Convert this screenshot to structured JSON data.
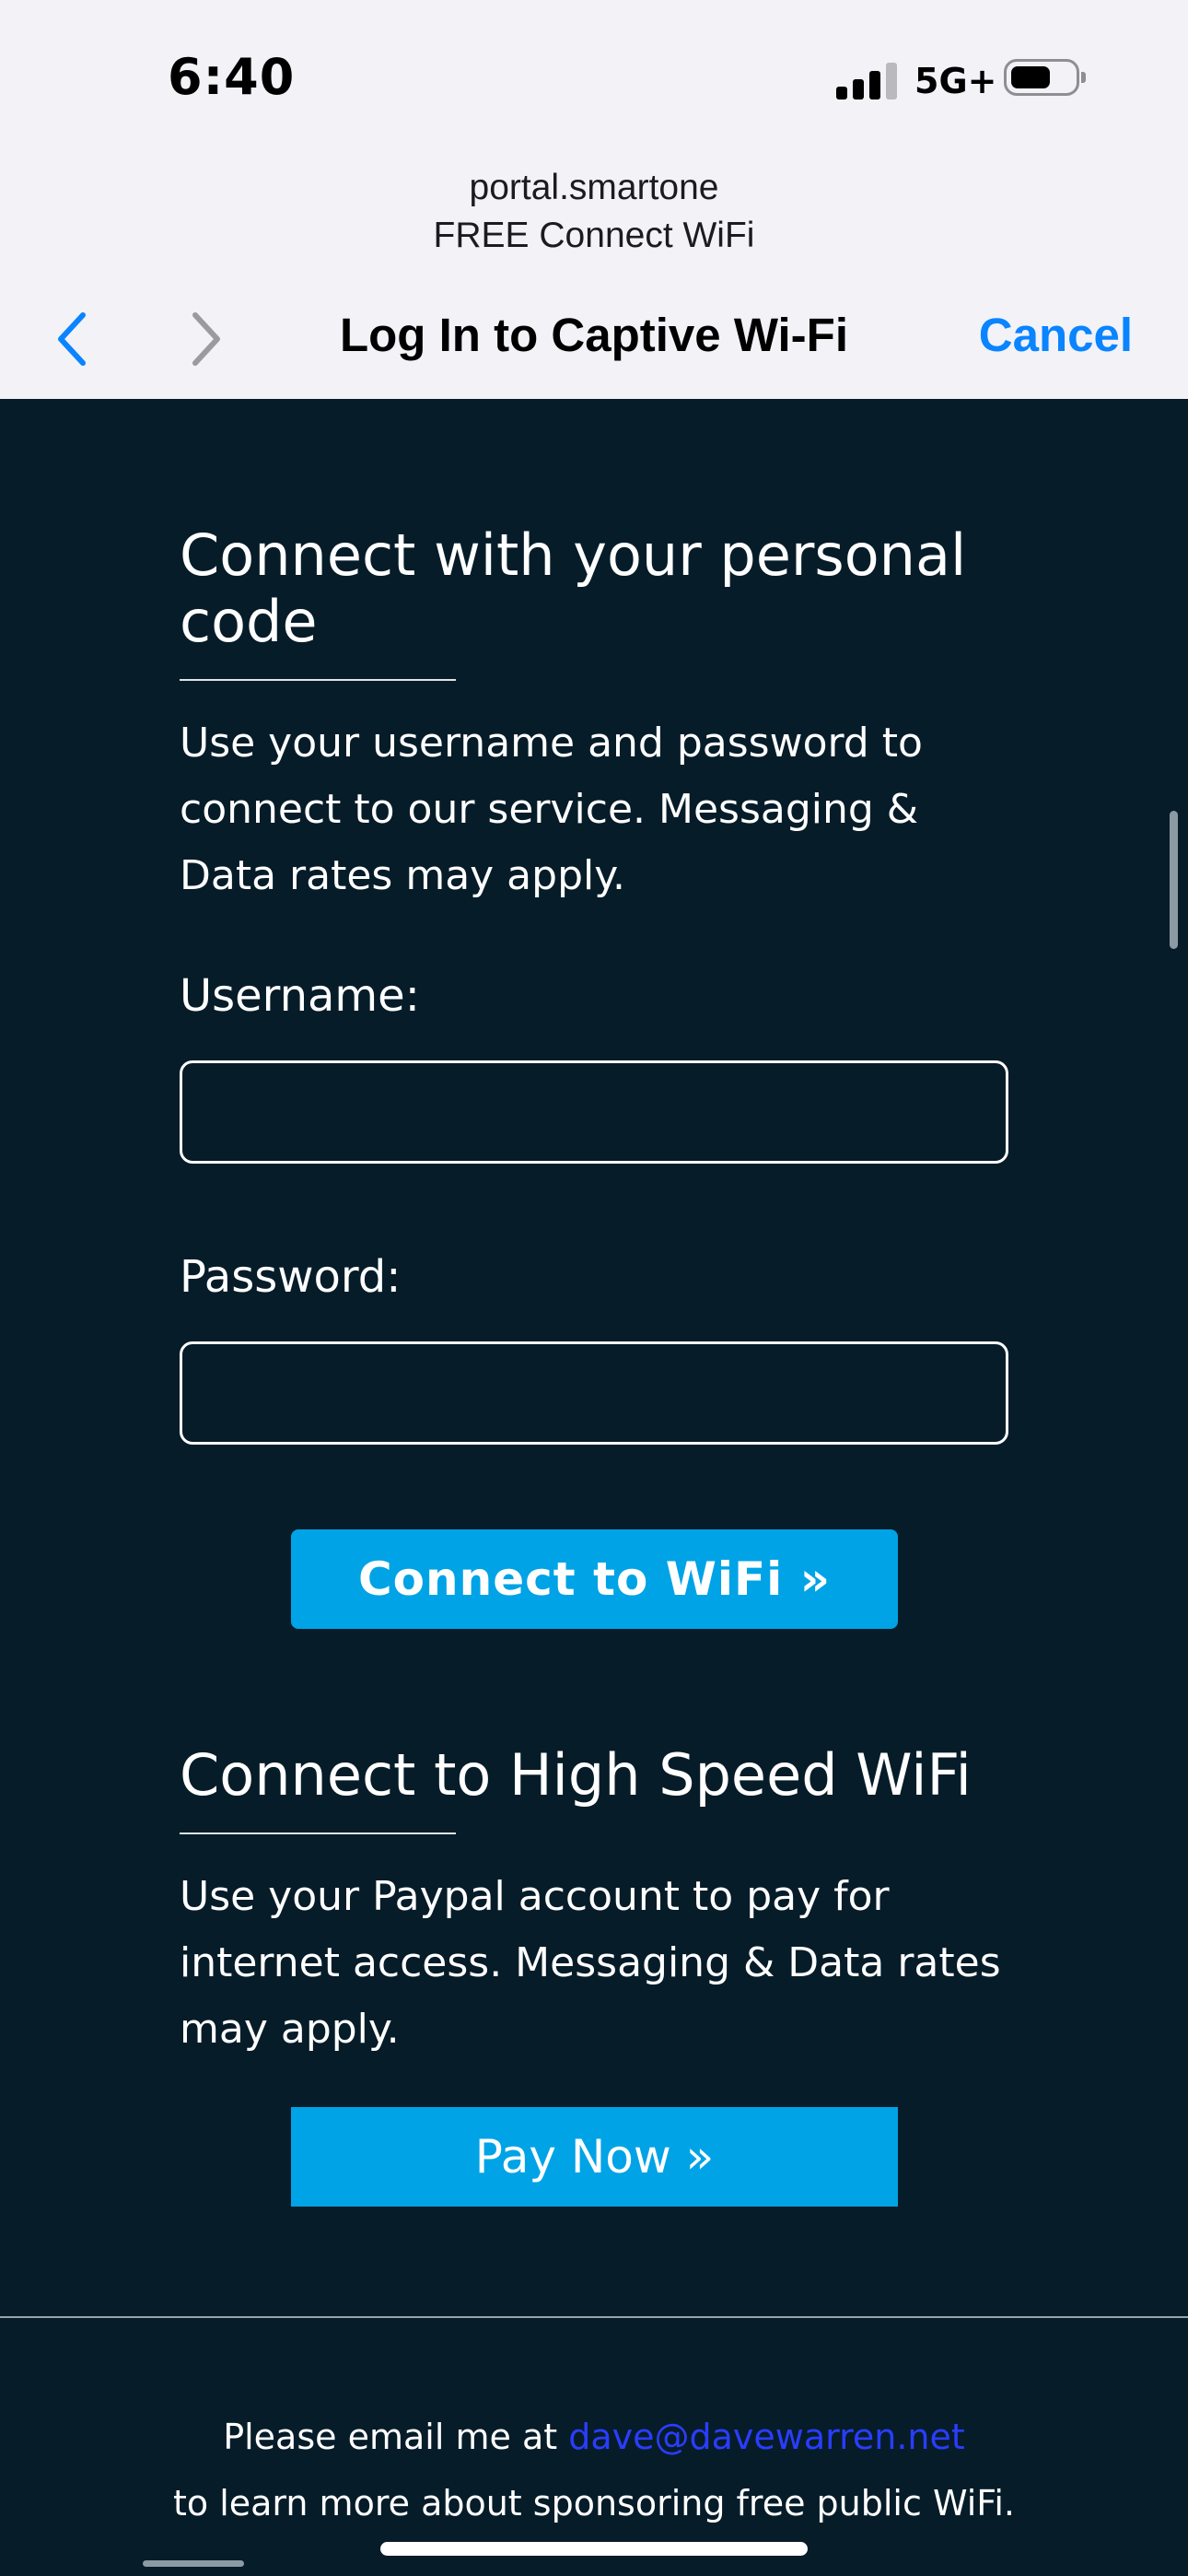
{
  "status_bar": {
    "time": "6:40",
    "network": "5G+",
    "battery_level": 0.6
  },
  "browser": {
    "host": "portal.smartone",
    "portal_name": "FREE Connect WiFi",
    "title": "Log In to Captive Wi-Fi",
    "cancel_label": "Cancel",
    "back_icon": "chevron-left-icon",
    "forward_icon": "chevron-right-icon"
  },
  "personal_code": {
    "heading": "Connect with your personal code",
    "description": "Use your username and password to connect to our service. Messaging & Data rates may apply.",
    "username_label": "Username:",
    "username_value": "",
    "password_label": "Password:",
    "password_value": "",
    "connect_button": "Connect to WiFi »"
  },
  "high_speed": {
    "heading": "Connect to High Speed WiFi",
    "description": "Use your Paypal account to pay for internet access. Messaging & Data rates may apply.",
    "pay_button": "Pay Now »"
  },
  "footer": {
    "text_before": "Please email me at ",
    "email": "dave@davewarren.net",
    "text_after": " to learn more about sponsoring free public WiFi."
  },
  "colors": {
    "background": "#061c29",
    "accent": "#00a3e6",
    "ios_blue": "#0a84ff",
    "link": "#2a3dff"
  }
}
